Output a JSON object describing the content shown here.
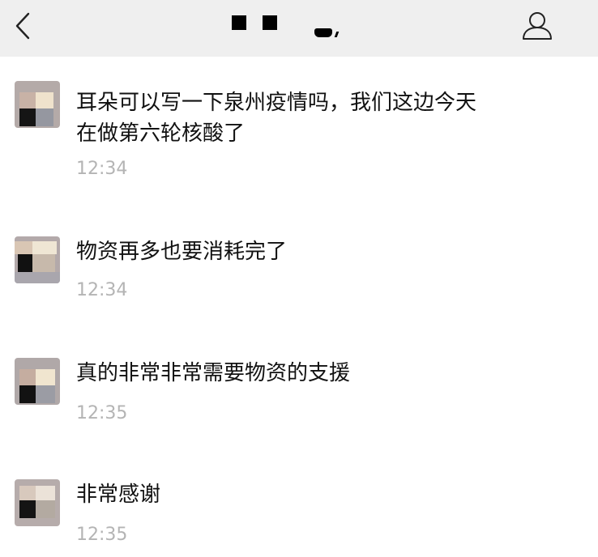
{
  "header": {
    "title": "",
    "back_icon": "chevron-left-icon",
    "profile_icon": "person-icon",
    "background": "#efefef"
  },
  "messages": [
    {
      "text": "耳朵可以写一下泉州疫情吗，我们这边今天\n在做第六轮核酸了",
      "time": "12:34"
    },
    {
      "text": "物资再多也要消耗完了",
      "time": "12:34"
    },
    {
      "text": "真的非常非常需要物资的支援",
      "time": "12:35"
    },
    {
      "text": "非常感谢",
      "time": "12:35"
    }
  ],
  "colors": {
    "text": "#111111",
    "timestamp": "#b4b4b4"
  }
}
